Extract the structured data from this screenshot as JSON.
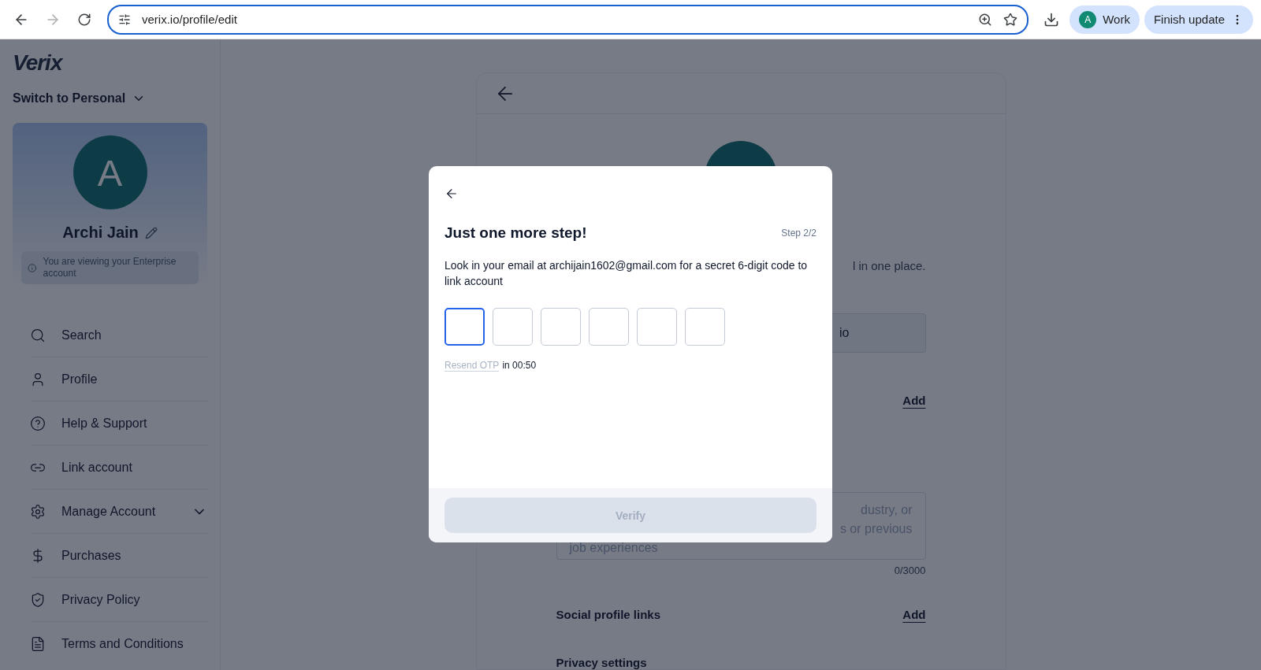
{
  "browser": {
    "forward_disabled": true,
    "url": "verix.io/profile/edit",
    "profile_initial": "A",
    "profile_name": "Work",
    "update_label": "Finish update"
  },
  "sidebar": {
    "logo": "Verix",
    "switch_label": "Switch to Personal",
    "profile": {
      "initial": "A",
      "name": "Archi Jain",
      "notice": "You are viewing your Enterprise account"
    },
    "items": [
      {
        "label": "Search",
        "kind": "link"
      },
      {
        "label": "Profile",
        "kind": "link"
      },
      {
        "label": "Help & Support",
        "kind": "link"
      },
      {
        "label": "Link account",
        "kind": "link"
      },
      {
        "label": "Manage Account",
        "kind": "group",
        "expanded": false
      },
      {
        "label": "Purchases",
        "kind": "link"
      },
      {
        "label": "Privacy Policy",
        "kind": "link"
      },
      {
        "label": "Terms and Conditions",
        "kind": "link"
      }
    ]
  },
  "profile_page": {
    "intro_fragment": "l in one place.",
    "field_fragment": "io",
    "add_link": "Add",
    "bio_lines": [
      "dustry, or",
      "s or previous",
      "job experiences"
    ],
    "bio_counter": "0/3000",
    "social_label": "Social profile links",
    "social_add": "Add",
    "privacy_label": "Privacy settings"
  },
  "dialog": {
    "title": "Just one more step!",
    "step": "Step 2/2",
    "message": "Look in your email at archijain1602@gmail.com for a secret 6-digit code to link account",
    "otp": [
      {
        "selected": true
      },
      {
        "selected": false
      },
      {
        "selected": false
      },
      {
        "selected": false
      },
      {
        "selected": false
      },
      {
        "selected": false
      }
    ],
    "resend": {
      "link": "Resend OTP",
      "suffix": "in 00:50",
      "disabled": true
    },
    "verify": {
      "label": "Verify",
      "disabled": true
    }
  }
}
